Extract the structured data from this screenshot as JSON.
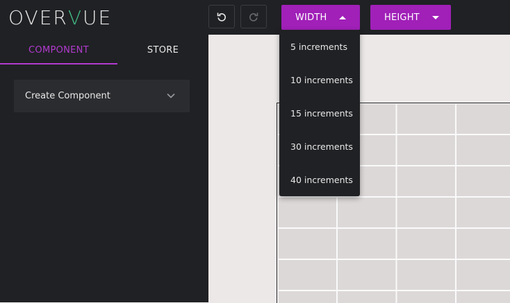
{
  "header": {
    "logo_pre": "OVER",
    "logo_v": "V",
    "logo_post": "UE",
    "undo_icon": "undo-icon",
    "redo_icon": "redo-icon",
    "width_label": "WIDTH",
    "height_label": "HEIGHT"
  },
  "sidebar": {
    "tabs": [
      {
        "label": "COMPONENT",
        "active": true
      },
      {
        "label": "STORE",
        "active": false
      }
    ],
    "panel": {
      "label": "Create Component"
    }
  },
  "width_menu": {
    "items": [
      {
        "label": "5 increments"
      },
      {
        "label": "10 increments"
      },
      {
        "label": "15 increments"
      },
      {
        "label": "30 increments"
      },
      {
        "label": "40 increments"
      }
    ]
  },
  "colors": {
    "accent": "#a020b8",
    "tab_active": "#b23ad0",
    "logo_v": "#41b883",
    "dark_bg": "#202124"
  }
}
